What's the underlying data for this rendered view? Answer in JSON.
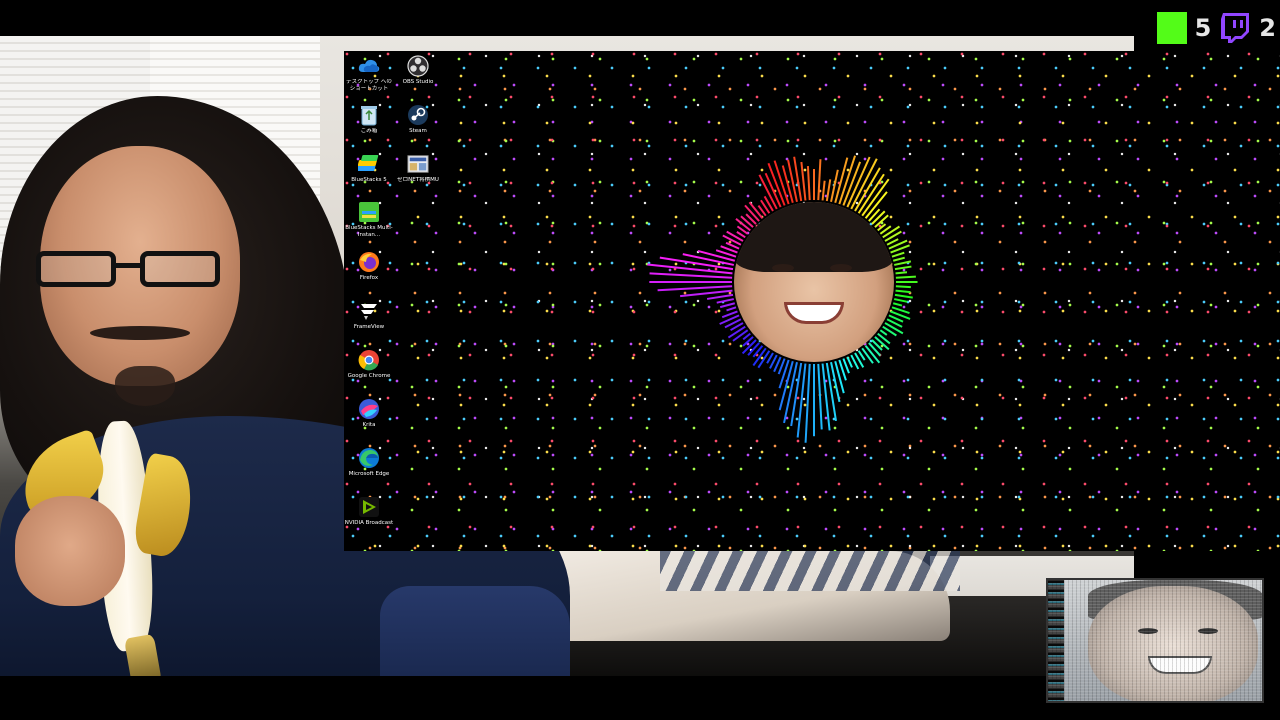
{
  "overlay": {
    "kick_count": "5",
    "twitch_count": "2",
    "kick_color": "#53fc18",
    "twitch_color": "#9146ff"
  },
  "desktop": {
    "icons_left": [
      {
        "label": "デスクトップ へのショートカット (OneDri...",
        "icon": "onedrive-icon"
      },
      {
        "label": "ごみ箱",
        "icon": "recycle-bin-icon"
      },
      {
        "label": "BlueStacks 5",
        "icon": "bluestacks-icon"
      },
      {
        "label": "BlueStacks Multi-Instan...",
        "icon": "bluestacks-multi-instance-icon"
      },
      {
        "label": "Firefox",
        "icon": "firefox-icon"
      },
      {
        "label": "FrameView",
        "icon": "frameview-icon"
      },
      {
        "label": "Google Chrome",
        "icon": "chrome-icon"
      },
      {
        "label": "Krita",
        "icon": "krita-icon"
      },
      {
        "label": "Microsoft Edge",
        "icon": "edge-icon"
      },
      {
        "label": "NVIDIA Broadcast",
        "icon": "nvidia-broadcast-icon"
      }
    ],
    "icons_right": [
      {
        "label": "OBS Studio",
        "icon": "obs-icon"
      },
      {
        "label": "Steam",
        "icon": "steam-icon"
      },
      {
        "label": "ゼロNET将棋MU",
        "icon": "shogi-icon"
      }
    ]
  }
}
